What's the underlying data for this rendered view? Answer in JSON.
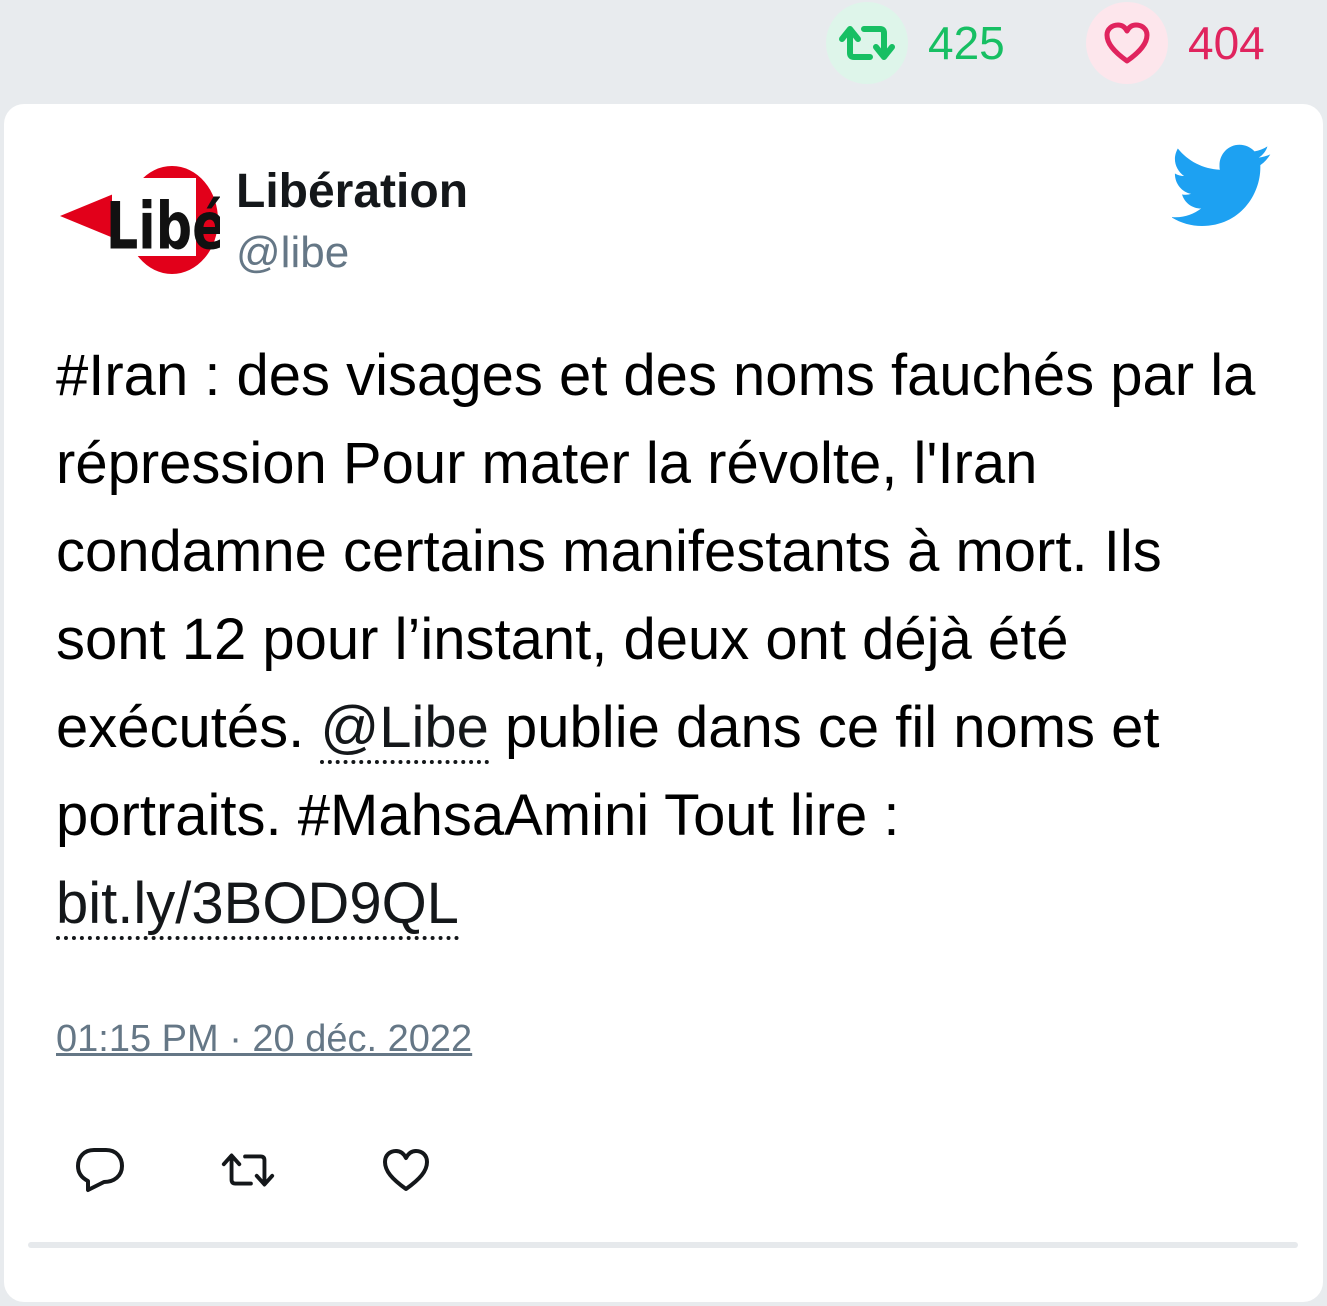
{
  "stats": {
    "retweets": "425",
    "likes": "404",
    "retweet_color": "#17bf63",
    "like_color": "#e0245e"
  },
  "author": {
    "name": "Libération",
    "handle": "@libe",
    "avatar_text": "Libé"
  },
  "tweet": {
    "text_part1": "#Iran : des visages et des noms fauchés par la répression Pour mater la révolte, l'Iran condamne certains manifestants à mort. Ils sont 12 pour l’instant, deux ont déjà été exécutés. ",
    "mention": "@Libe",
    "text_part2": " publie dans ce fil noms et portraits. #MahsaAmini Tout lire : ",
    "link": "bit.ly/3BOD9QL"
  },
  "timestamp": "01:15 PM · 20 déc. 2022",
  "actions": {
    "reply_icon": "reply-icon",
    "retweet_icon": "retweet-icon",
    "like_icon": "heart-icon"
  },
  "brand": {
    "twitter_blue": "#1da1f2",
    "libe_red": "#e2001a"
  }
}
